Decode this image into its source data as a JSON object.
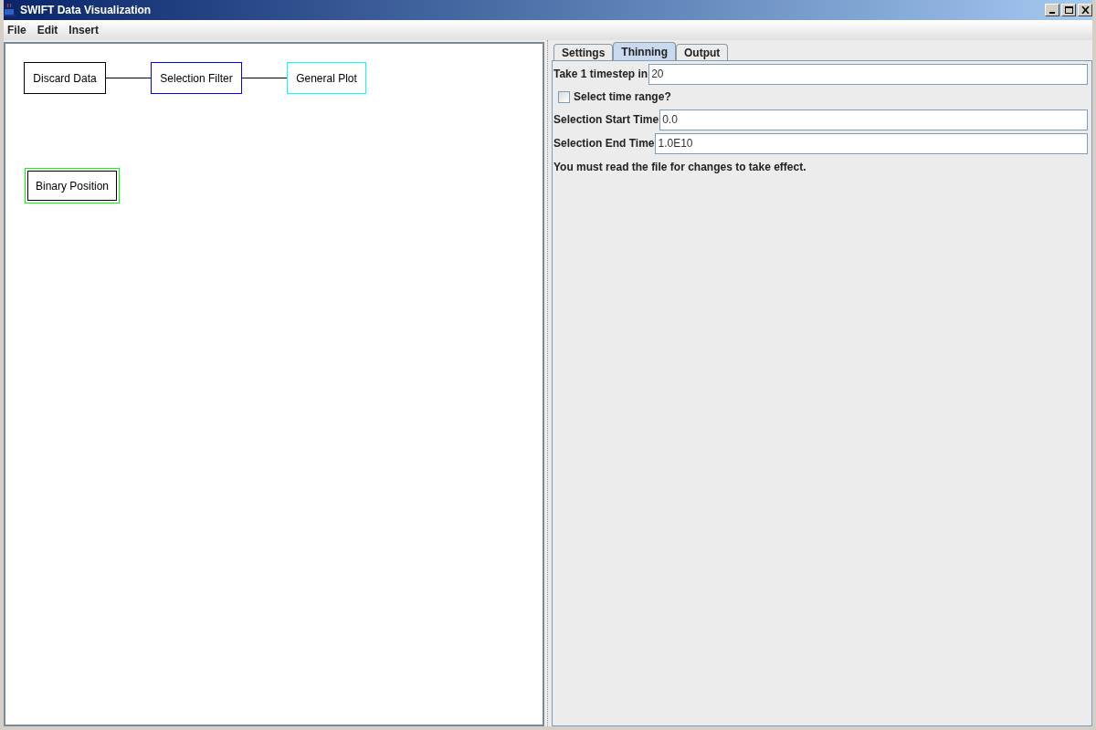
{
  "window": {
    "title": "SWIFT Data Visualization"
  },
  "menu": [
    "File",
    "Edit",
    "Insert"
  ],
  "nodes": [
    {
      "label": "Discard Data",
      "color": "#000000",
      "selected": false,
      "linked": true
    },
    {
      "label": "Selection Filter",
      "color": "#0000ff",
      "selected": false,
      "linked": true
    },
    {
      "label": "General Plot",
      "color": "#00ffff",
      "selected": false,
      "linked": false
    },
    {
      "label": "Binary Position",
      "color": "#000000",
      "selected": true
    }
  ],
  "tabs": [
    {
      "label": "Settings",
      "selected": false
    },
    {
      "label": "Thinning",
      "selected": true
    },
    {
      "label": "Output",
      "selected": false
    }
  ],
  "form": [
    {
      "kind": "field",
      "label": "Take 1 timestep in",
      "value": "20"
    },
    {
      "kind": "checkbox",
      "label": "Select time range?",
      "checked": false
    },
    {
      "kind": "field",
      "label": "Selection Start Time",
      "value": "0.0"
    },
    {
      "kind": "field",
      "label": "Selection End Time",
      "value": "1.0E10"
    },
    {
      "kind": "note",
      "label": "You must read the file for changes to take effect."
    }
  ]
}
